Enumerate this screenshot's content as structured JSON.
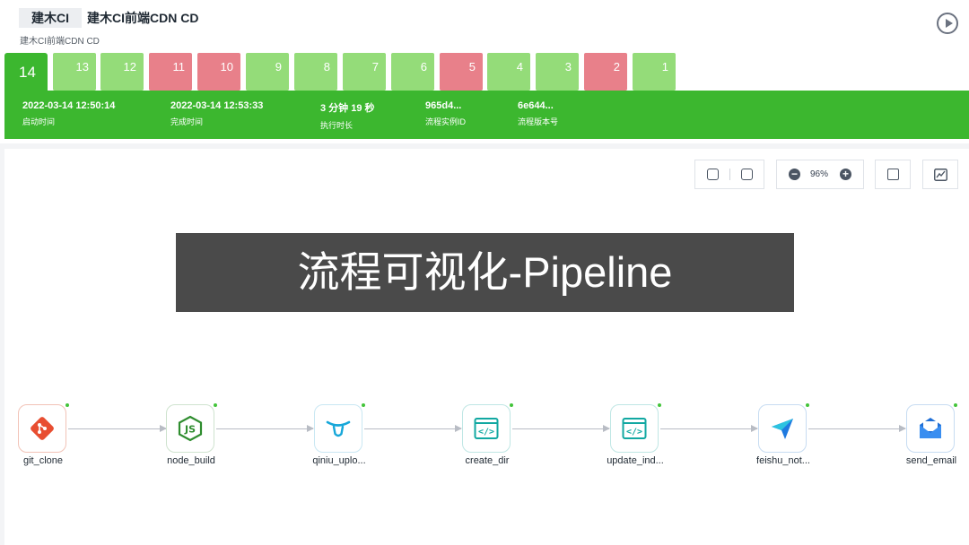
{
  "header": {
    "project": "建木CI",
    "pipeline": "建木CI前端CDN CD",
    "subtitle": "建木CI前端CDN CD",
    "run_icon": "play-circle-icon"
  },
  "runs": [
    {
      "number": "14",
      "status": "success",
      "active": true
    },
    {
      "number": "13",
      "status": "success"
    },
    {
      "number": "12",
      "status": "success"
    },
    {
      "number": "11",
      "status": "failed"
    },
    {
      "number": "10",
      "status": "failed"
    },
    {
      "number": "9",
      "status": "success"
    },
    {
      "number": "8",
      "status": "success"
    },
    {
      "number": "7",
      "status": "success"
    },
    {
      "number": "6",
      "status": "success"
    },
    {
      "number": "5",
      "status": "failed"
    },
    {
      "number": "4",
      "status": "success"
    },
    {
      "number": "3",
      "status": "success"
    },
    {
      "number": "2",
      "status": "failed"
    },
    {
      "number": "1",
      "status": "success"
    }
  ],
  "details": {
    "start": {
      "value": "2022-03-14 12:50:14",
      "label": "启动时间"
    },
    "end": {
      "value": "2022-03-14 12:53:33",
      "label": "完成时间"
    },
    "duration": {
      "value": "3 分钟 19 秒",
      "label": "执行时长"
    },
    "instance": {
      "value": "965d4...",
      "label": "流程实例ID"
    },
    "version": {
      "value": "6e644...",
      "label": "流程版本号"
    }
  },
  "toolbar": {
    "zoom": "96%",
    "fit_icon": "fit-screen-icon",
    "center_icon": "focus-center-icon",
    "zoom_out_icon": "minus-circle-icon",
    "zoom_in_icon": "plus-circle-icon",
    "log_icon": "document-icon",
    "chart_icon": "line-chart-icon"
  },
  "banner": "流程可视化-Pipeline",
  "nodes": [
    {
      "label": "git_clone",
      "icon": "git-icon"
    },
    {
      "label": "node_build",
      "icon": "nodejs-icon"
    },
    {
      "label": "qiniu_uplo...",
      "icon": "qiniu-icon"
    },
    {
      "label": "create_dir",
      "icon": "code-window-icon"
    },
    {
      "label": "update_ind...",
      "icon": "code-window-icon"
    },
    {
      "label": "feishu_not...",
      "icon": "paper-plane-icon"
    },
    {
      "label": "send_email",
      "icon": "email-icon"
    }
  ],
  "colors": {
    "success": "#3cb72f",
    "success_light": "#94dc79",
    "failed": "#e8808a"
  }
}
